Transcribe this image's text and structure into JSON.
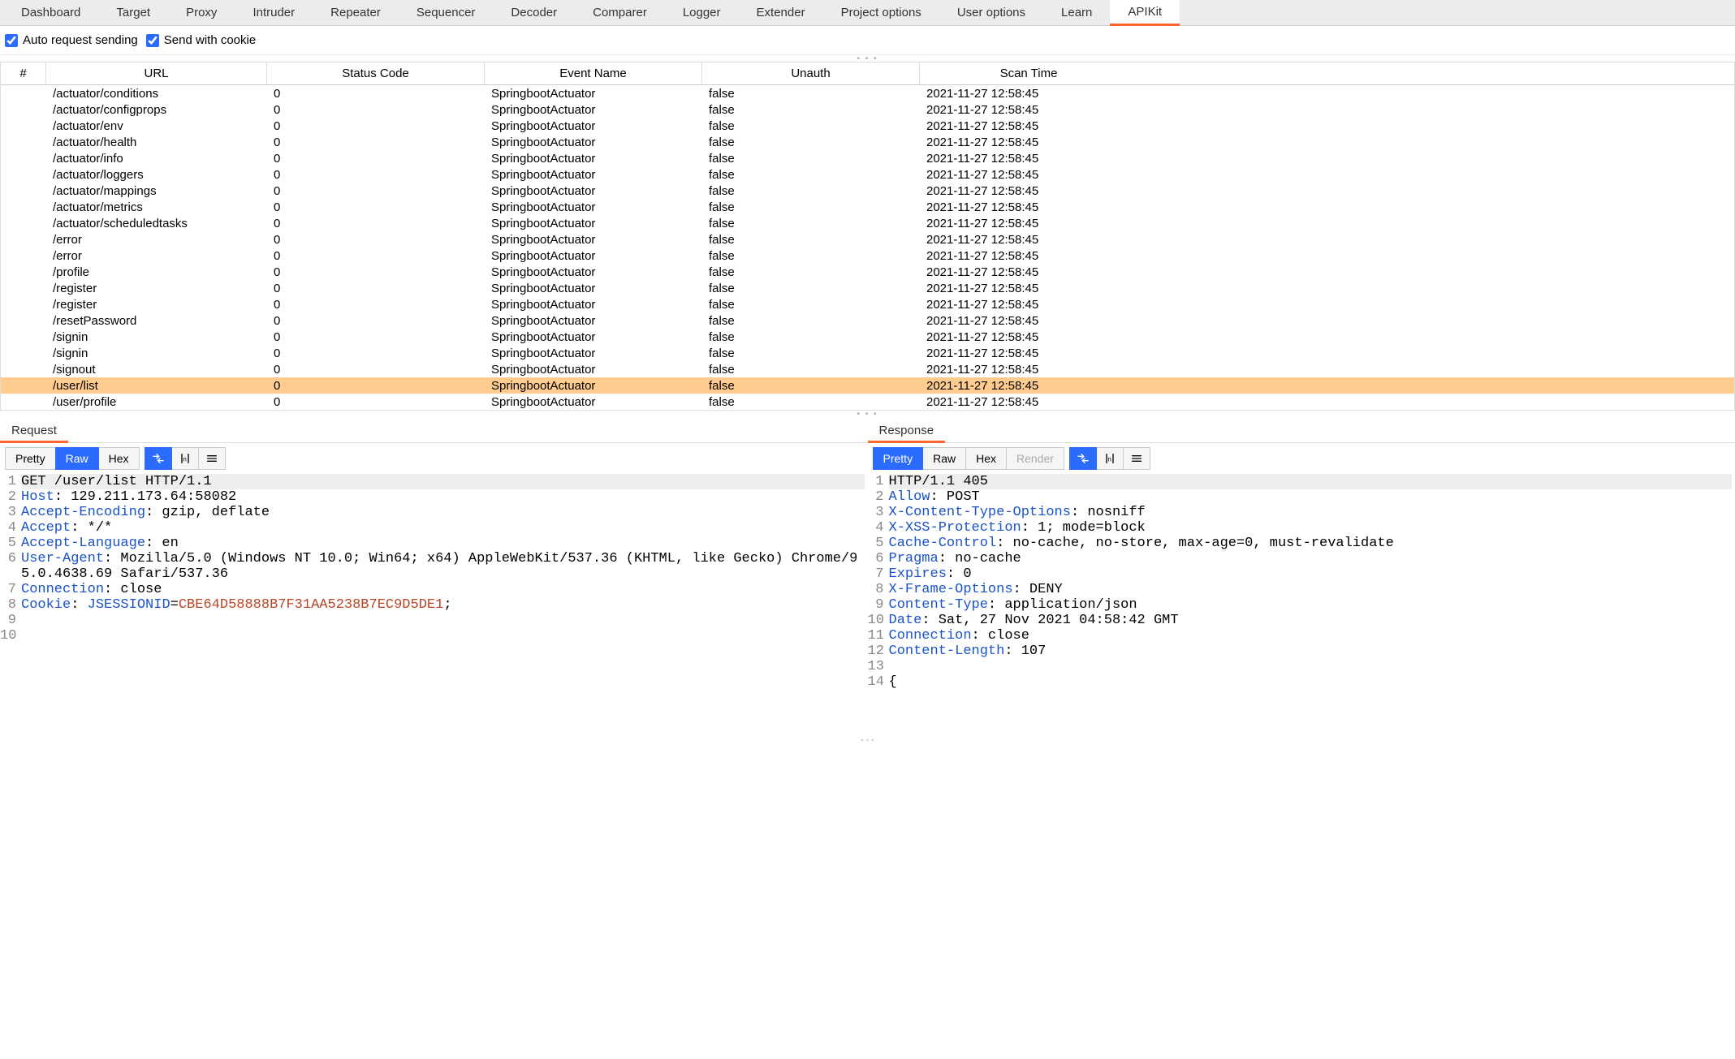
{
  "tabs": [
    "Dashboard",
    "Target",
    "Proxy",
    "Intruder",
    "Repeater",
    "Sequencer",
    "Decoder",
    "Comparer",
    "Logger",
    "Extender",
    "Project options",
    "User options",
    "Learn",
    "APIKit"
  ],
  "active_tab_index": 13,
  "options": {
    "auto_request": {
      "label": "Auto request sending",
      "checked": true
    },
    "send_cookie": {
      "label": "Send with cookie",
      "checked": true
    }
  },
  "columns": [
    "#",
    "URL",
    "Status Code",
    "Event Name",
    "Unauth",
    "Scan Time"
  ],
  "rows": [
    {
      "url": "/actuator/conditions",
      "status": "0",
      "event": "SpringbootActuator",
      "unauth": "false",
      "time": "2021-11-27 12:58:45"
    },
    {
      "url": "/actuator/configprops",
      "status": "0",
      "event": "SpringbootActuator",
      "unauth": "false",
      "time": "2021-11-27 12:58:45"
    },
    {
      "url": "/actuator/env",
      "status": "0",
      "event": "SpringbootActuator",
      "unauth": "false",
      "time": "2021-11-27 12:58:45"
    },
    {
      "url": "/actuator/health",
      "status": "0",
      "event": "SpringbootActuator",
      "unauth": "false",
      "time": "2021-11-27 12:58:45"
    },
    {
      "url": "/actuator/info",
      "status": "0",
      "event": "SpringbootActuator",
      "unauth": "false",
      "time": "2021-11-27 12:58:45"
    },
    {
      "url": "/actuator/loggers",
      "status": "0",
      "event": "SpringbootActuator",
      "unauth": "false",
      "time": "2021-11-27 12:58:45"
    },
    {
      "url": "/actuator/mappings",
      "status": "0",
      "event": "SpringbootActuator",
      "unauth": "false",
      "time": "2021-11-27 12:58:45"
    },
    {
      "url": "/actuator/metrics",
      "status": "0",
      "event": "SpringbootActuator",
      "unauth": "false",
      "time": "2021-11-27 12:58:45"
    },
    {
      "url": "/actuator/scheduledtasks",
      "status": "0",
      "event": "SpringbootActuator",
      "unauth": "false",
      "time": "2021-11-27 12:58:45"
    },
    {
      "url": "/error",
      "status": "0",
      "event": "SpringbootActuator",
      "unauth": "false",
      "time": "2021-11-27 12:58:45"
    },
    {
      "url": "/error",
      "status": "0",
      "event": "SpringbootActuator",
      "unauth": "false",
      "time": "2021-11-27 12:58:45"
    },
    {
      "url": "/profile",
      "status": "0",
      "event": "SpringbootActuator",
      "unauth": "false",
      "time": "2021-11-27 12:58:45"
    },
    {
      "url": "/register",
      "status": "0",
      "event": "SpringbootActuator",
      "unauth": "false",
      "time": "2021-11-27 12:58:45"
    },
    {
      "url": "/register",
      "status": "0",
      "event": "SpringbootActuator",
      "unauth": "false",
      "time": "2021-11-27 12:58:45"
    },
    {
      "url": "/resetPassword",
      "status": "0",
      "event": "SpringbootActuator",
      "unauth": "false",
      "time": "2021-11-27 12:58:45"
    },
    {
      "url": "/signin",
      "status": "0",
      "event": "SpringbootActuator",
      "unauth": "false",
      "time": "2021-11-27 12:58:45"
    },
    {
      "url": "/signin",
      "status": "0",
      "event": "SpringbootActuator",
      "unauth": "false",
      "time": "2021-11-27 12:58:45"
    },
    {
      "url": "/signout",
      "status": "0",
      "event": "SpringbootActuator",
      "unauth": "false",
      "time": "2021-11-27 12:58:45"
    },
    {
      "url": "/user/list",
      "status": "0",
      "event": "SpringbootActuator",
      "unauth": "false",
      "time": "2021-11-27 12:58:45",
      "selected": true
    },
    {
      "url": "/user/profile",
      "status": "0",
      "event": "SpringbootActuator",
      "unauth": "false",
      "time": "2021-11-27 12:58:45"
    }
  ],
  "panes": {
    "request": {
      "title": "Request",
      "view_buttons": [
        "Pretty",
        "Raw",
        "Hex"
      ],
      "active_view": "Raw",
      "lines": [
        {
          "n": "1",
          "t": "GET /user/list HTTP/1.1",
          "first": true
        },
        {
          "n": "2",
          "k": "Host",
          "v": " 129.211.173.64:58082"
        },
        {
          "n": "3",
          "k": "Accept-Encoding",
          "v": " gzip, deflate"
        },
        {
          "n": "4",
          "k": "Accept",
          "v": " */*"
        },
        {
          "n": "5",
          "k": "Accept-Language",
          "v": " en"
        },
        {
          "n": "6",
          "k": "User-Agent",
          "v": " Mozilla/5.0 (Windows NT 10.0; Win64; x64) AppleWebKit/537.36 (KHTML, like Gecko) Chrome/95.0.4638.69 Safari/537.36"
        },
        {
          "n": "7",
          "k": "Connection",
          "v": " close"
        },
        {
          "n": "8",
          "k": "Cookie",
          "v": " ",
          "ck": "JSESSIONID",
          "cv": "CBE64D58888B7F31AA5238B7EC9D5DE1",
          "tail": ";"
        },
        {
          "n": "9",
          "t": ""
        },
        {
          "n": "10",
          "t": ""
        }
      ]
    },
    "response": {
      "title": "Response",
      "view_buttons": [
        "Pretty",
        "Raw",
        "Hex",
        "Render"
      ],
      "active_view": "Pretty",
      "lines": [
        {
          "n": "1",
          "t": "HTTP/1.1 405",
          "first": true
        },
        {
          "n": "2",
          "k": "Allow",
          "v": " POST"
        },
        {
          "n": "3",
          "k": "X-Content-Type-Options",
          "v": " nosniff"
        },
        {
          "n": "4",
          "k": "X-XSS-Protection",
          "v": " 1; mode=block"
        },
        {
          "n": "5",
          "k": "Cache-Control",
          "v": " no-cache, no-store, max-age=0, must-revalidate"
        },
        {
          "n": "6",
          "k": "Pragma",
          "v": " no-cache"
        },
        {
          "n": "7",
          "k": "Expires",
          "v": " 0"
        },
        {
          "n": "8",
          "k": "X-Frame-Options",
          "v": " DENY"
        },
        {
          "n": "9",
          "k": "Content-Type",
          "v": " application/json"
        },
        {
          "n": "10",
          "k": "Date",
          "v": " Sat, 27 Nov 2021 04:58:42 GMT"
        },
        {
          "n": "11",
          "k": "Connection",
          "v": " close"
        },
        {
          "n": "12",
          "k": "Content-Length",
          "v": " 107"
        },
        {
          "n": "13",
          "t": ""
        },
        {
          "n": "14",
          "t": "{"
        }
      ]
    }
  }
}
